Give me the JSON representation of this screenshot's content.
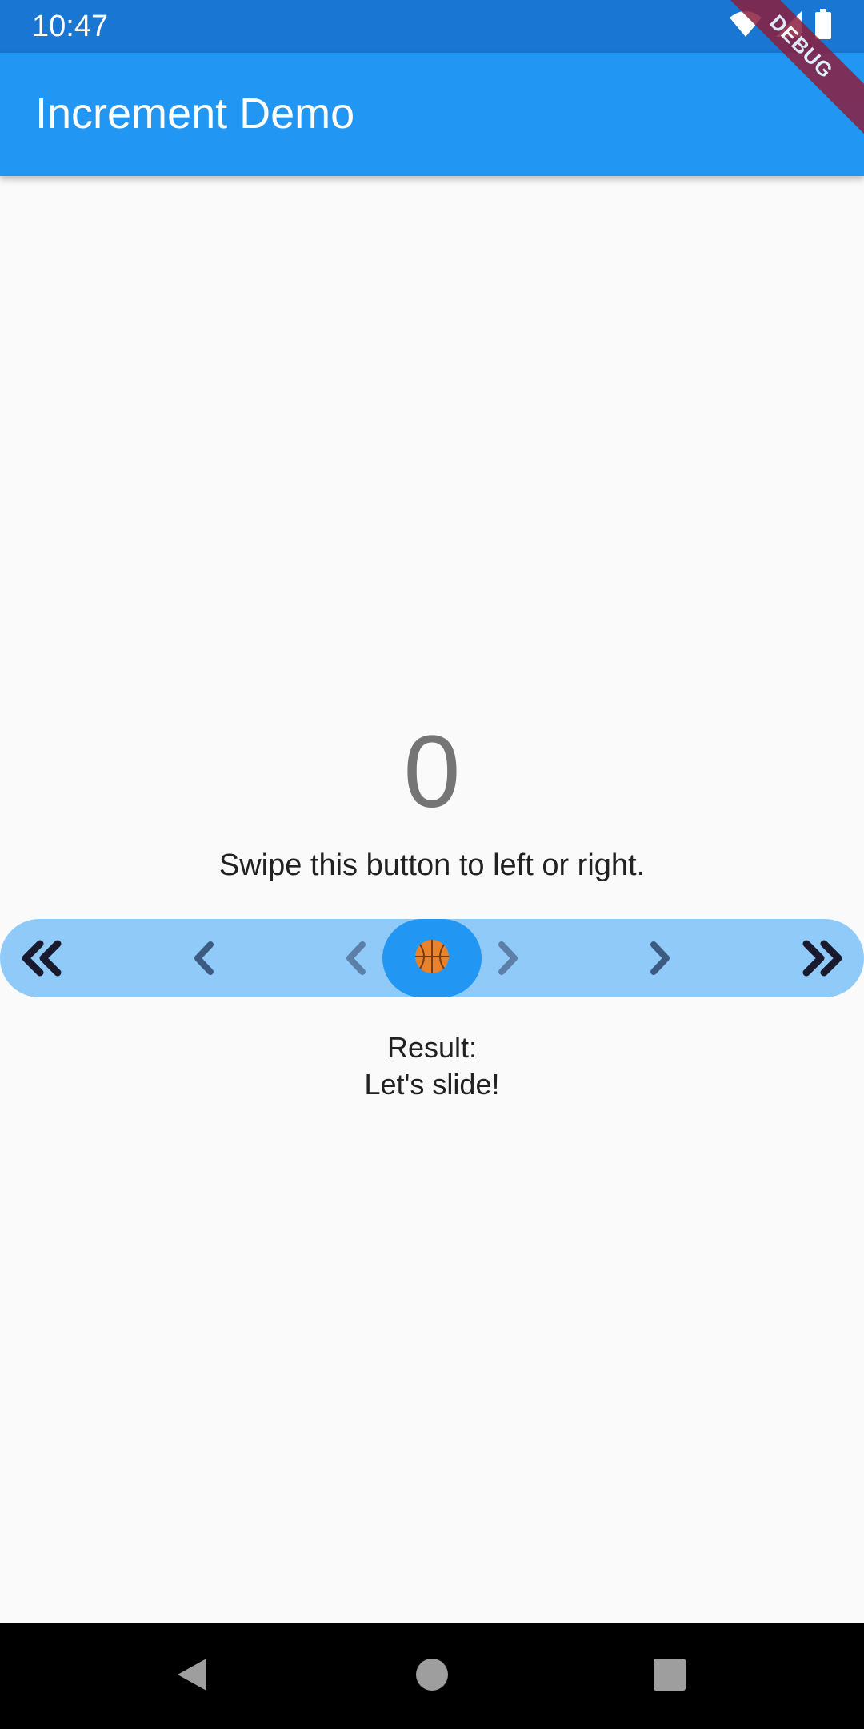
{
  "status_bar": {
    "time": "10:47",
    "icons": [
      "wifi-icon",
      "signal-icon",
      "battery-icon"
    ]
  },
  "debug_banner": "DEBUG",
  "app_bar": {
    "title": "Increment Demo"
  },
  "main": {
    "counter": "0",
    "instruction": "Swipe this button to left or right.",
    "result_label": "Result:",
    "result_value": "Let's slide!"
  },
  "slider": {
    "icons": [
      "double-chevron-left-icon",
      "chevron-left-icon",
      "chevron-left-faint-icon",
      "basketball-icon",
      "chevron-right-faint-icon",
      "chevron-right-icon",
      "double-chevron-right-icon"
    ]
  },
  "nav_bar": {
    "buttons": [
      "back-icon",
      "home-icon",
      "recents-icon"
    ]
  },
  "colors": {
    "status_bar": "#1976d2",
    "app_bar": "#2196f3",
    "slider_track": "#90caf9",
    "slider_thumb": "#2196f3",
    "debug_ribbon": "#8b1e3f"
  }
}
